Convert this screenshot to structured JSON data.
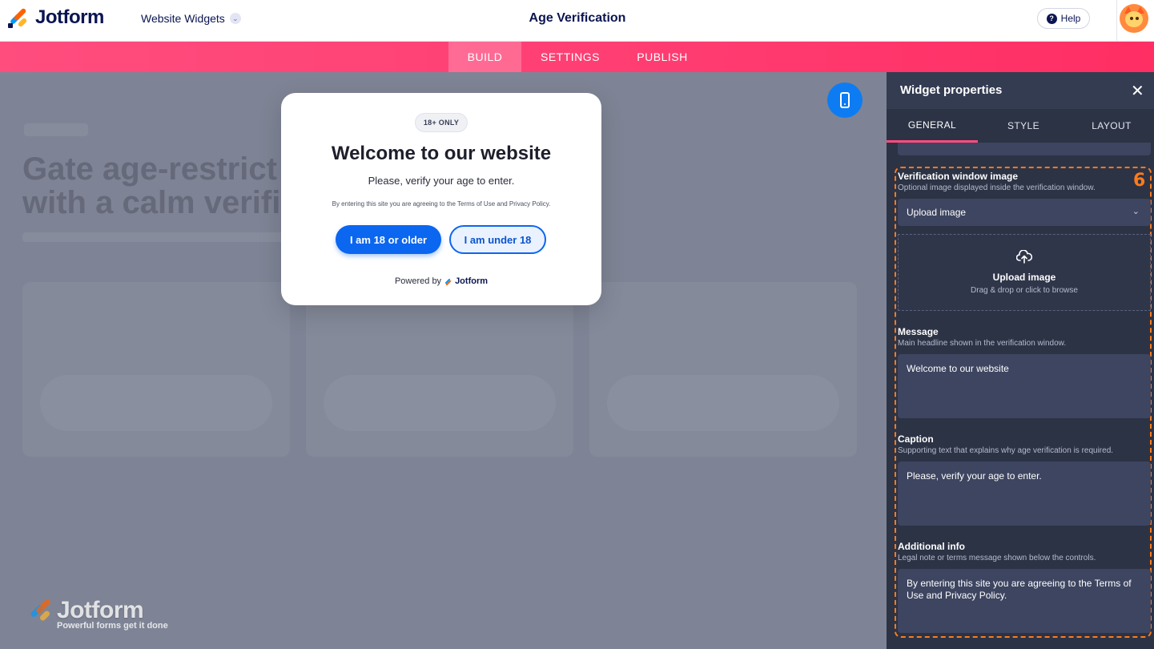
{
  "header": {
    "brand": "Jotform",
    "workspace": "Website Widgets",
    "title": "Age Verification",
    "help_label": "Help"
  },
  "nav": {
    "tabs": [
      {
        "label": "BUILD",
        "active": true
      },
      {
        "label": "SETTINGS",
        "active": false
      },
      {
        "label": "PUBLISH",
        "active": false
      }
    ]
  },
  "preview": {
    "background_title_line1": "Gate age-restrict",
    "background_title_line2": "with a calm verifi",
    "modal": {
      "badge": "18+ ONLY",
      "title": "Welcome to our website",
      "caption": "Please, verify your age to enter.",
      "legal": "By entering this site you are agreeing to the Terms of Use and Privacy Policy.",
      "primary_button": "I am 18 or older",
      "secondary_button": "I am under 18",
      "powered_prefix": "Powered by",
      "powered_brand": "Jotform"
    },
    "watermark": {
      "brand": "Jotform",
      "tagline": "Powerful forms get it done"
    }
  },
  "panel": {
    "title": "Widget properties",
    "tabs": [
      {
        "label": "GENERAL",
        "active": true
      },
      {
        "label": "STYLE",
        "active": false
      },
      {
        "label": "LAYOUT",
        "active": false
      }
    ],
    "highlight_number": "6",
    "fields": {
      "image": {
        "label": "Verification window image",
        "help": "Optional image displayed inside the verification window.",
        "select_value": "Upload image",
        "dropzone_title": "Upload image",
        "dropzone_sub": "Drag & drop or click to browse"
      },
      "message": {
        "label": "Message",
        "help": "Main headline shown in the verification window.",
        "value": "Welcome to our website"
      },
      "caption": {
        "label": "Caption",
        "help": "Supporting text that explains why age verification is required.",
        "value": "Please, verify your age to enter."
      },
      "additional": {
        "label": "Additional info",
        "help": "Legal note or terms message shown below the controls.",
        "value": "By entering this site you are agreeing to the Terms of Use and Privacy Policy."
      }
    }
  },
  "colors": {
    "accent_pink": "#ff3f74",
    "primary_blue": "#0b66f0",
    "highlight_orange": "#ff7b1c",
    "panel_bg": "#2c3345"
  }
}
